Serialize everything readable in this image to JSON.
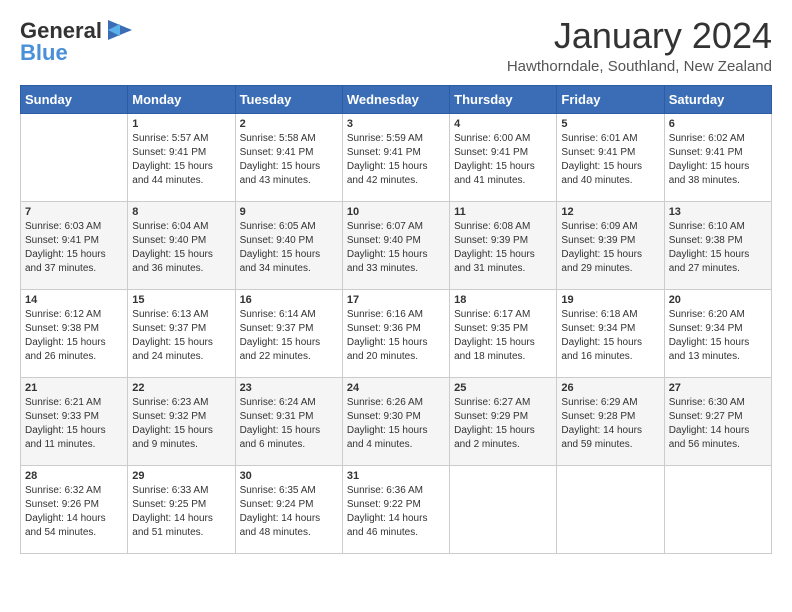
{
  "header": {
    "logo_general": "General",
    "logo_blue": "Blue",
    "month_title": "January 2024",
    "location": "Hawthorndale, Southland, New Zealand"
  },
  "weekdays": [
    "Sunday",
    "Monday",
    "Tuesday",
    "Wednesday",
    "Thursday",
    "Friday",
    "Saturday"
  ],
  "weeks": [
    [
      {
        "day": "",
        "sunrise": "",
        "sunset": "",
        "daylight": ""
      },
      {
        "day": "1",
        "sunrise": "5:57 AM",
        "sunset": "9:41 PM",
        "daylight": "15 hours and 44 minutes."
      },
      {
        "day": "2",
        "sunrise": "5:58 AM",
        "sunset": "9:41 PM",
        "daylight": "15 hours and 43 minutes."
      },
      {
        "day": "3",
        "sunrise": "5:59 AM",
        "sunset": "9:41 PM",
        "daylight": "15 hours and 42 minutes."
      },
      {
        "day": "4",
        "sunrise": "6:00 AM",
        "sunset": "9:41 PM",
        "daylight": "15 hours and 41 minutes."
      },
      {
        "day": "5",
        "sunrise": "6:01 AM",
        "sunset": "9:41 PM",
        "daylight": "15 hours and 40 minutes."
      },
      {
        "day": "6",
        "sunrise": "6:02 AM",
        "sunset": "9:41 PM",
        "daylight": "15 hours and 38 minutes."
      }
    ],
    [
      {
        "day": "7",
        "sunrise": "6:03 AM",
        "sunset": "9:41 PM",
        "daylight": "15 hours and 37 minutes."
      },
      {
        "day": "8",
        "sunrise": "6:04 AM",
        "sunset": "9:40 PM",
        "daylight": "15 hours and 36 minutes."
      },
      {
        "day": "9",
        "sunrise": "6:05 AM",
        "sunset": "9:40 PM",
        "daylight": "15 hours and 34 minutes."
      },
      {
        "day": "10",
        "sunrise": "6:07 AM",
        "sunset": "9:40 PM",
        "daylight": "15 hours and 33 minutes."
      },
      {
        "day": "11",
        "sunrise": "6:08 AM",
        "sunset": "9:39 PM",
        "daylight": "15 hours and 31 minutes."
      },
      {
        "day": "12",
        "sunrise": "6:09 AM",
        "sunset": "9:39 PM",
        "daylight": "15 hours and 29 minutes."
      },
      {
        "day": "13",
        "sunrise": "6:10 AM",
        "sunset": "9:38 PM",
        "daylight": "15 hours and 27 minutes."
      }
    ],
    [
      {
        "day": "14",
        "sunrise": "6:12 AM",
        "sunset": "9:38 PM",
        "daylight": "15 hours and 26 minutes."
      },
      {
        "day": "15",
        "sunrise": "6:13 AM",
        "sunset": "9:37 PM",
        "daylight": "15 hours and 24 minutes."
      },
      {
        "day": "16",
        "sunrise": "6:14 AM",
        "sunset": "9:37 PM",
        "daylight": "15 hours and 22 minutes."
      },
      {
        "day": "17",
        "sunrise": "6:16 AM",
        "sunset": "9:36 PM",
        "daylight": "15 hours and 20 minutes."
      },
      {
        "day": "18",
        "sunrise": "6:17 AM",
        "sunset": "9:35 PM",
        "daylight": "15 hours and 18 minutes."
      },
      {
        "day": "19",
        "sunrise": "6:18 AM",
        "sunset": "9:34 PM",
        "daylight": "15 hours and 16 minutes."
      },
      {
        "day": "20",
        "sunrise": "6:20 AM",
        "sunset": "9:34 PM",
        "daylight": "15 hours and 13 minutes."
      }
    ],
    [
      {
        "day": "21",
        "sunrise": "6:21 AM",
        "sunset": "9:33 PM",
        "daylight": "15 hours and 11 minutes."
      },
      {
        "day": "22",
        "sunrise": "6:23 AM",
        "sunset": "9:32 PM",
        "daylight": "15 hours and 9 minutes."
      },
      {
        "day": "23",
        "sunrise": "6:24 AM",
        "sunset": "9:31 PM",
        "daylight": "15 hours and 6 minutes."
      },
      {
        "day": "24",
        "sunrise": "6:26 AM",
        "sunset": "9:30 PM",
        "daylight": "15 hours and 4 minutes."
      },
      {
        "day": "25",
        "sunrise": "6:27 AM",
        "sunset": "9:29 PM",
        "daylight": "15 hours and 2 minutes."
      },
      {
        "day": "26",
        "sunrise": "6:29 AM",
        "sunset": "9:28 PM",
        "daylight": "14 hours and 59 minutes."
      },
      {
        "day": "27",
        "sunrise": "6:30 AM",
        "sunset": "9:27 PM",
        "daylight": "14 hours and 56 minutes."
      }
    ],
    [
      {
        "day": "28",
        "sunrise": "6:32 AM",
        "sunset": "9:26 PM",
        "daylight": "14 hours and 54 minutes."
      },
      {
        "day": "29",
        "sunrise": "6:33 AM",
        "sunset": "9:25 PM",
        "daylight": "14 hours and 51 minutes."
      },
      {
        "day": "30",
        "sunrise": "6:35 AM",
        "sunset": "9:24 PM",
        "daylight": "14 hours and 48 minutes."
      },
      {
        "day": "31",
        "sunrise": "6:36 AM",
        "sunset": "9:22 PM",
        "daylight": "14 hours and 46 minutes."
      },
      {
        "day": "",
        "sunrise": "",
        "sunset": "",
        "daylight": ""
      },
      {
        "day": "",
        "sunrise": "",
        "sunset": "",
        "daylight": ""
      },
      {
        "day": "",
        "sunrise": "",
        "sunset": "",
        "daylight": ""
      }
    ]
  ]
}
